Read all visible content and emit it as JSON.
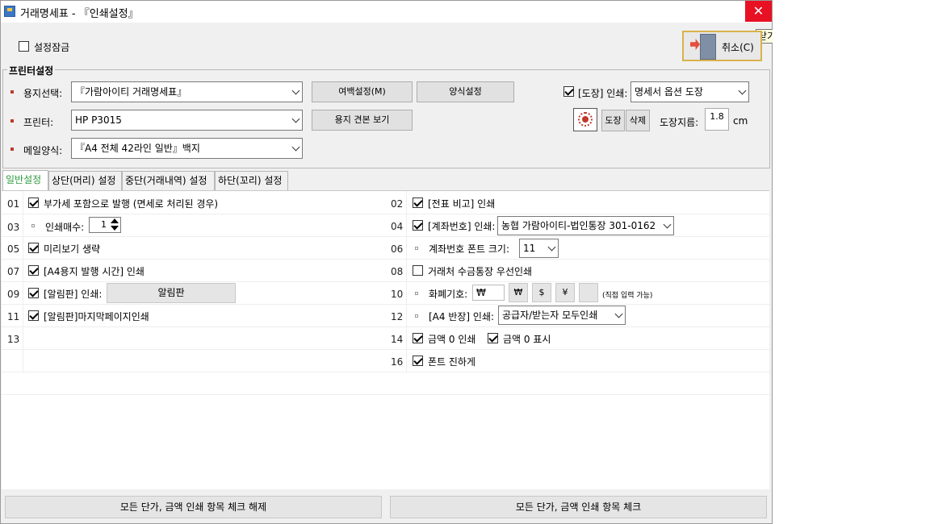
{
  "window": {
    "title": "거래명세표 - 『인쇄설정』",
    "close_glyph": "✕",
    "tooltip": "닫기"
  },
  "top": {
    "lock_label": "설정잠금",
    "lock_checked": false,
    "cancel_label": "취소(C)"
  },
  "printer_group": {
    "title": "프린터설정",
    "paper_label": "용지선택:",
    "paper_value": "『가람아이티 거래명세표』",
    "margin_button": "여백설정(M)",
    "form_button": "양식설정",
    "printer_label": "프린터:",
    "printer_value": "HP P3015",
    "sample_button": "용지 견본 보기",
    "mail_label": "메일양식:",
    "mail_value": "『A4 전체 42라인 일반』백지",
    "stamp_check_label": "[도장] 인쇄:",
    "stamp_checked": true,
    "stamp_value": "명세서 옵션 도장",
    "stamp_btn": "도장",
    "delete_btn": "삭제",
    "stamp_size_label": "도장지름:",
    "stamp_size_value": "1.8",
    "stamp_size_unit": "cm"
  },
  "tabs": [
    "일반설정",
    "상단(머리) 설정",
    "중단(거래내역) 설정",
    "하단(꼬리) 설정"
  ],
  "left_rows": [
    {
      "num": "01",
      "label": "부가세 포함으로 발행 (면세로 처리된 경우)",
      "checked": true
    },
    {
      "num": "03",
      "label": "인쇄매수:",
      "value": "1"
    },
    {
      "num": "05",
      "label": "미리보기 생략",
      "checked": true
    },
    {
      "num": "07",
      "label": "[A4용지 발행 시간] 인쇄",
      "checked": true
    },
    {
      "num": "09",
      "label": "[알림판] 인쇄:",
      "checked": true,
      "button": "알림판"
    },
    {
      "num": "11",
      "label": "[알림판]마지막페이지인쇄",
      "checked": true
    },
    {
      "num": "13",
      "label": ""
    }
  ],
  "right_rows": [
    {
      "num": "02",
      "label": "[전표 비고] 인쇄",
      "checked": true
    },
    {
      "num": "04",
      "label": "[계좌번호] 인쇄:",
      "checked": true,
      "value": "농협 가람아이티-법인통장 301-0162"
    },
    {
      "num": "06",
      "label": "계좌번호 폰트 크기:",
      "value": "11"
    },
    {
      "num": "08",
      "label": "거래처 수금통장 우선인쇄",
      "checked": false
    },
    {
      "num": "10",
      "label": "화폐기호:",
      "value": "₩",
      "symbols": [
        "₩",
        "$",
        "¥",
        ""
      ],
      "note": "(직접 입력 가능)"
    },
    {
      "num": "12",
      "label": "[A4 반장] 인쇄:",
      "value": "공급자/받는자 모두인쇄"
    },
    {
      "num": "14",
      "label": "금액 0 인쇄",
      "checked": true,
      "label2": "금액 0 표시",
      "checked2": true
    },
    {
      "num": "16",
      "label": "폰트 진하게",
      "checked": true
    }
  ],
  "bottom": {
    "uncheck_all": "모든 단가, 금액 인쇄 항목 체크 해제",
    "check_all": "모든 단가, 금액 인쇄 항목 체크"
  },
  "colors": {
    "close": "#e81123",
    "active_tab": "#2e9c3e",
    "bullet": "#c0392b"
  }
}
